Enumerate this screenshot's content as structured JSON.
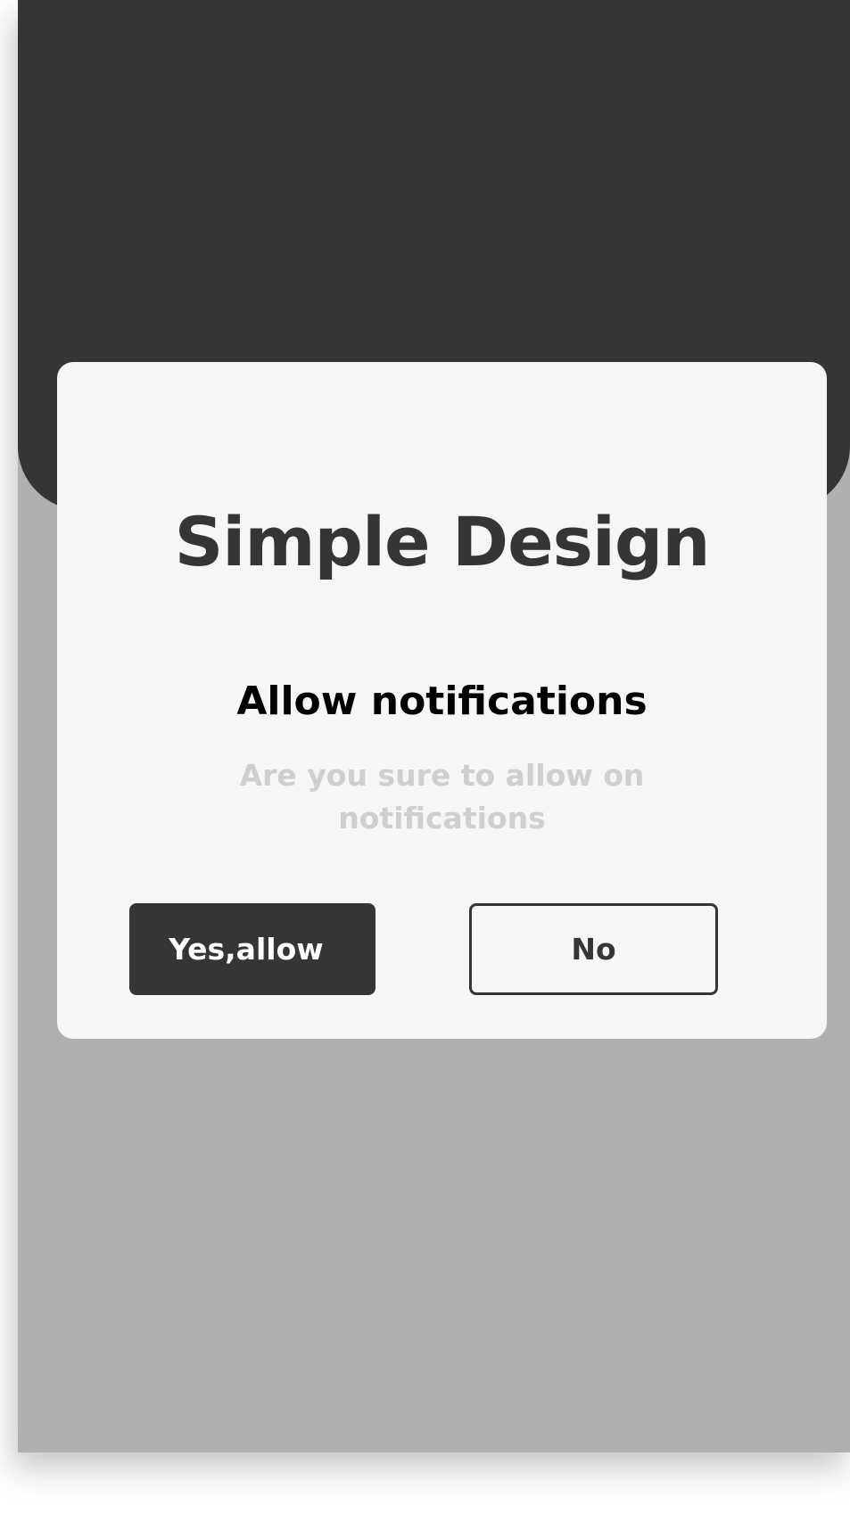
{
  "app": {
    "title": "Simple Design"
  },
  "dialog": {
    "heading": "Allow notifications",
    "message": "Are you sure to allow on notifications",
    "confirm_label": "Yes,allow",
    "cancel_label": "No"
  },
  "colors": {
    "dark": "#353535",
    "overlay": "#b0b0b0",
    "dialog_bg": "#f6f6f6",
    "message_text": "#cfcfcf"
  }
}
